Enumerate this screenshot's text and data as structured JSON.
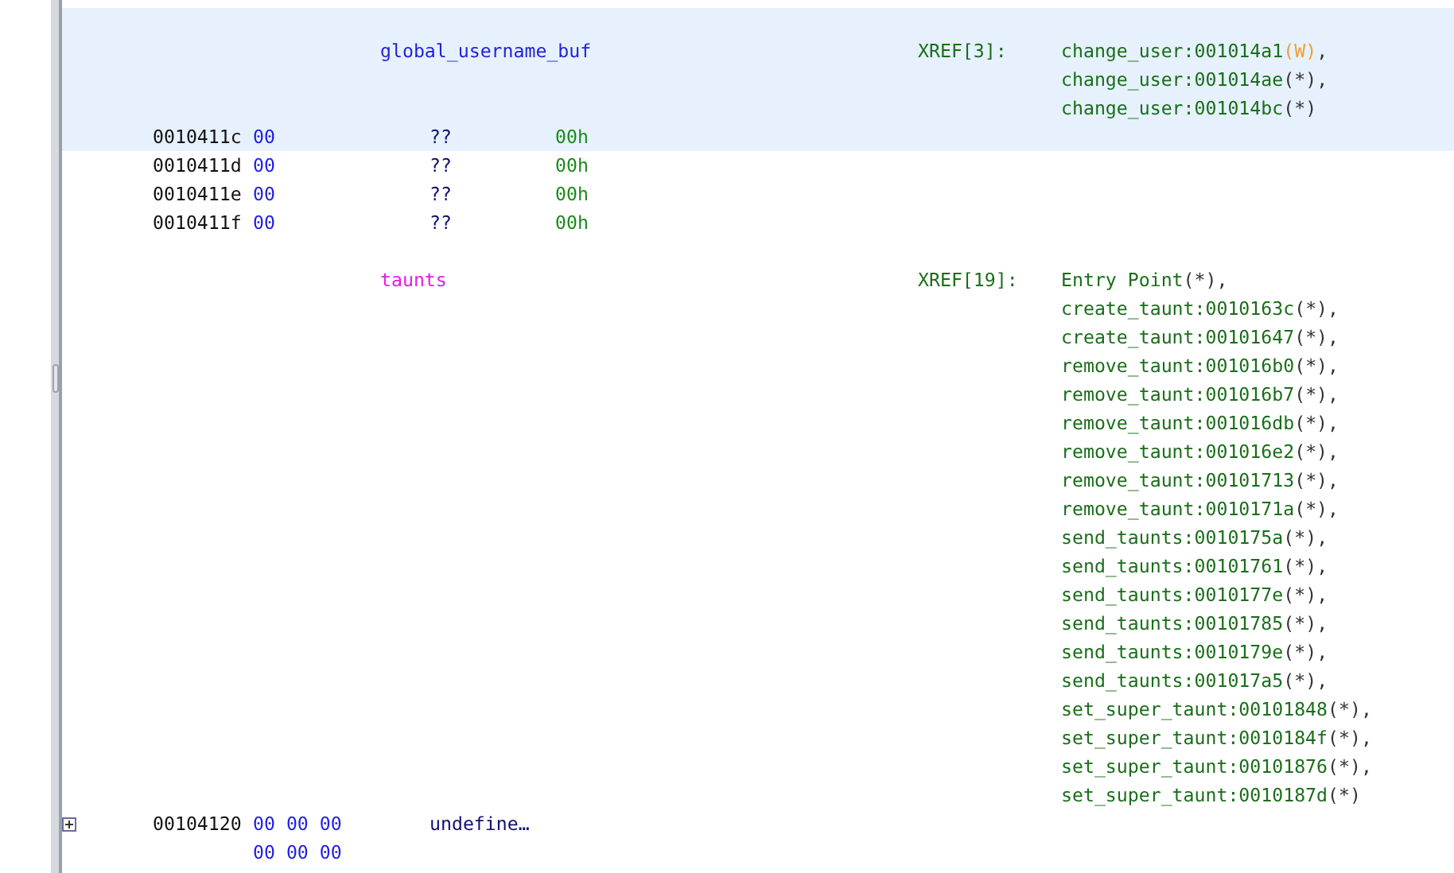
{
  "listing": [
    {
      "kind": "label",
      "highlighted": true,
      "name": "global_username_buf",
      "color": "#2222dd",
      "xref_head": "XREF[3]:",
      "xrefs": [
        {
          "ref": "change_user:001014a1",
          "access": "(W)",
          "color": "#f0a030",
          "sep": ","
        },
        {
          "ref": "change_user:001014ae",
          "access": "(*)",
          "color": "#333333",
          "sep": ","
        },
        {
          "ref": "change_user:001014bc",
          "access": "(*)",
          "color": "#333333"
        }
      ]
    },
    {
      "kind": "code",
      "highlighted": true,
      "address": "0010411c",
      "bytes": [
        "00"
      ],
      "mnemonic": "??",
      "operand": "00h"
    },
    {
      "kind": "code",
      "highlighted": false,
      "address": "0010411d",
      "bytes": [
        "00"
      ],
      "mnemonic": "??",
      "operand": "00h"
    },
    {
      "kind": "code",
      "highlighted": false,
      "address": "0010411e",
      "bytes": [
        "00"
      ],
      "mnemonic": "??",
      "operand": "00h"
    },
    {
      "kind": "code",
      "highlighted": false,
      "address": "0010411f",
      "bytes": [
        "00"
      ],
      "mnemonic": "??",
      "operand": "00h"
    },
    {
      "kind": "label",
      "highlighted": false,
      "name": "taunts",
      "color": "#e020e0",
      "xref_head": "XREF[19]:",
      "xrefs": [
        {
          "ref": "Entry Point",
          "access": "(*)",
          "color": "#333333",
          "sep": ","
        },
        {
          "ref": "create_taunt:0010163c",
          "access": "(*)",
          "color": "#333333",
          "sep": ","
        },
        {
          "ref": "create_taunt:00101647",
          "access": "(*)",
          "color": "#333333",
          "sep": ","
        },
        {
          "ref": "remove_taunt:001016b0",
          "access": "(*)",
          "color": "#333333",
          "sep": ","
        },
        {
          "ref": "remove_taunt:001016b7",
          "access": "(*)",
          "color": "#333333",
          "sep": ","
        },
        {
          "ref": "remove_taunt:001016db",
          "access": "(*)",
          "color": "#333333",
          "sep": ","
        },
        {
          "ref": "remove_taunt:001016e2",
          "access": "(*)",
          "color": "#333333",
          "sep": ","
        },
        {
          "ref": "remove_taunt:00101713",
          "access": "(*)",
          "color": "#333333",
          "sep": ","
        },
        {
          "ref": "remove_taunt:0010171a",
          "access": "(*)",
          "color": "#333333",
          "sep": ","
        },
        {
          "ref": "send_taunts:0010175a",
          "access": "(*)",
          "color": "#333333",
          "sep": ","
        },
        {
          "ref": "send_taunts:00101761",
          "access": "(*)",
          "color": "#333333",
          "sep": ","
        },
        {
          "ref": "send_taunts:0010177e",
          "access": "(*)",
          "color": "#333333",
          "sep": ","
        },
        {
          "ref": "send_taunts:00101785",
          "access": "(*)",
          "color": "#333333",
          "sep": ","
        },
        {
          "ref": "send_taunts:0010179e",
          "access": "(*)",
          "color": "#333333",
          "sep": ","
        },
        {
          "ref": "send_taunts:001017a5",
          "access": "(*)",
          "color": "#333333",
          "sep": ","
        },
        {
          "ref": "set_super_taunt:00101848",
          "access": "(*)",
          "color": "#333333",
          "sep": ","
        },
        {
          "ref": "set_super_taunt:0010184f",
          "access": "(*)",
          "color": "#333333",
          "sep": ","
        },
        {
          "ref": "set_super_taunt:00101876",
          "access": "(*)",
          "color": "#333333",
          "sep": ","
        },
        {
          "ref": "set_super_taunt:0010187d",
          "access": "(*)",
          "color": "#333333"
        }
      ]
    },
    {
      "kind": "code",
      "highlighted": false,
      "address": "00104120",
      "bytes": [
        "00 00 00",
        "00 00 00"
      ],
      "mnemonic": "undefine…",
      "expander": {
        "expanded": false
      }
    }
  ]
}
